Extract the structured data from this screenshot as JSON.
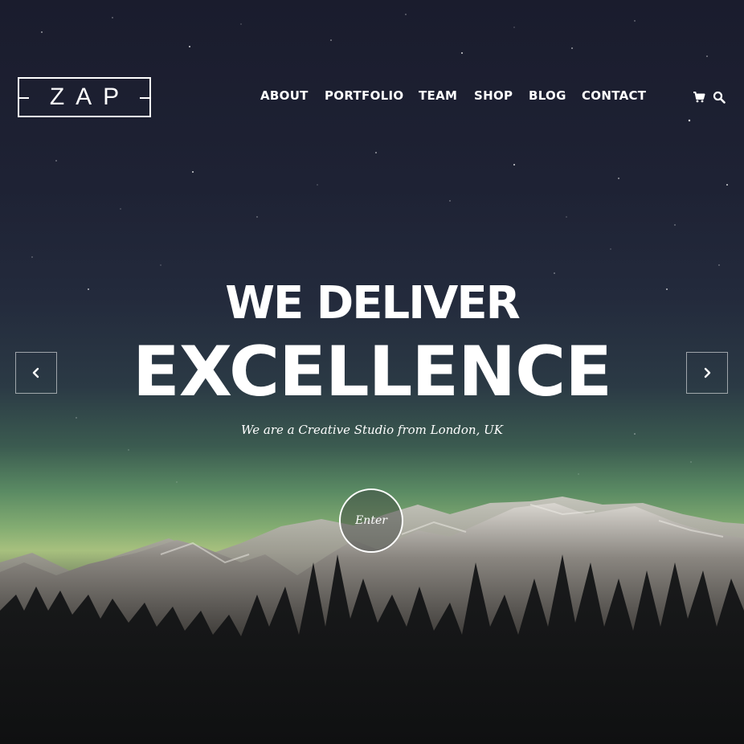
{
  "brand": {
    "logo_text": "ZAP"
  },
  "nav": {
    "items": [
      {
        "label": "ABOUT"
      },
      {
        "label": "PORTFOLIO"
      },
      {
        "label": "TEAM"
      },
      {
        "label": "SHOP"
      },
      {
        "label": "BLOG"
      },
      {
        "label": "CONTACT"
      }
    ],
    "icons": [
      "cart-icon",
      "search-icon"
    ]
  },
  "hero": {
    "headline_line1": "WE DELIVER",
    "headline_line2": "EXCELLENCE",
    "tagline": "We are a Creative Studio from London, UK",
    "cta_label": "Enter",
    "arrows": [
      "chevron-left-icon",
      "chevron-right-icon"
    ]
  },
  "colors": {
    "text": "#ffffff",
    "sky_top": "#1a1c2d",
    "aurora": "#a7c07e"
  }
}
